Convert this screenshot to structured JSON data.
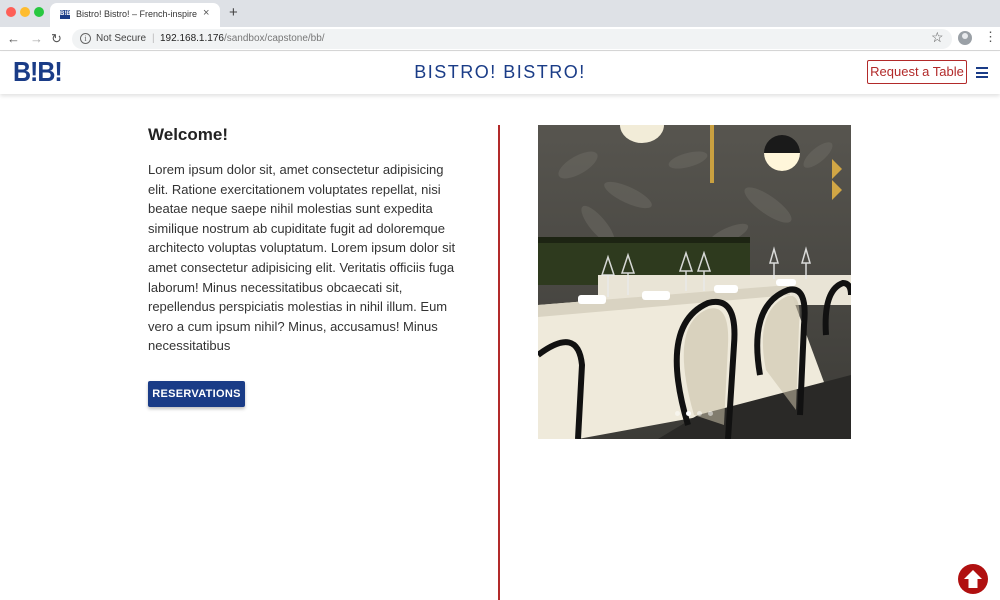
{
  "browser": {
    "tab_title": "Bistro! Bistro! – French-inspire",
    "tab_favicon_text": "B!B!",
    "tab_close": "×",
    "new_tab": "+",
    "security_label": "Not Secure",
    "separator": "|",
    "url_host": "192.168.1.176",
    "url_path": "/sandbox/capstone/bb/"
  },
  "header": {
    "logo": "B!B!",
    "title": "BISTRO! BISTRO!",
    "request_label": "Request a Table"
  },
  "main": {
    "heading": "Welcome!",
    "body": "Lorem ipsum dolor sit, amet consectetur adipisicing elit. Ratione exercitationem voluptates repellat, nisi beatae neque saepe nihil molestias sunt expedita similique nostrum ab cupiditate fugit ad doloremque architecto voluptas voluptatum. Lorem ipsum dolor sit amet consectetur adipisicing elit. Veritatis officiis fuga laborum! Minus necessitatibus obcaecati sit, repellendus perspiciatis molestias in nihil illum. Eum vero a cum ipsum nihil? Minus, accusamus! Minus necessitatibus",
    "reservations_label": "RESERVATIONS"
  },
  "carousel": {
    "slide_count": 4,
    "active_index": 1
  },
  "colors": {
    "brand_blue": "#1a3c87",
    "accent_red": "#b22a2a"
  }
}
